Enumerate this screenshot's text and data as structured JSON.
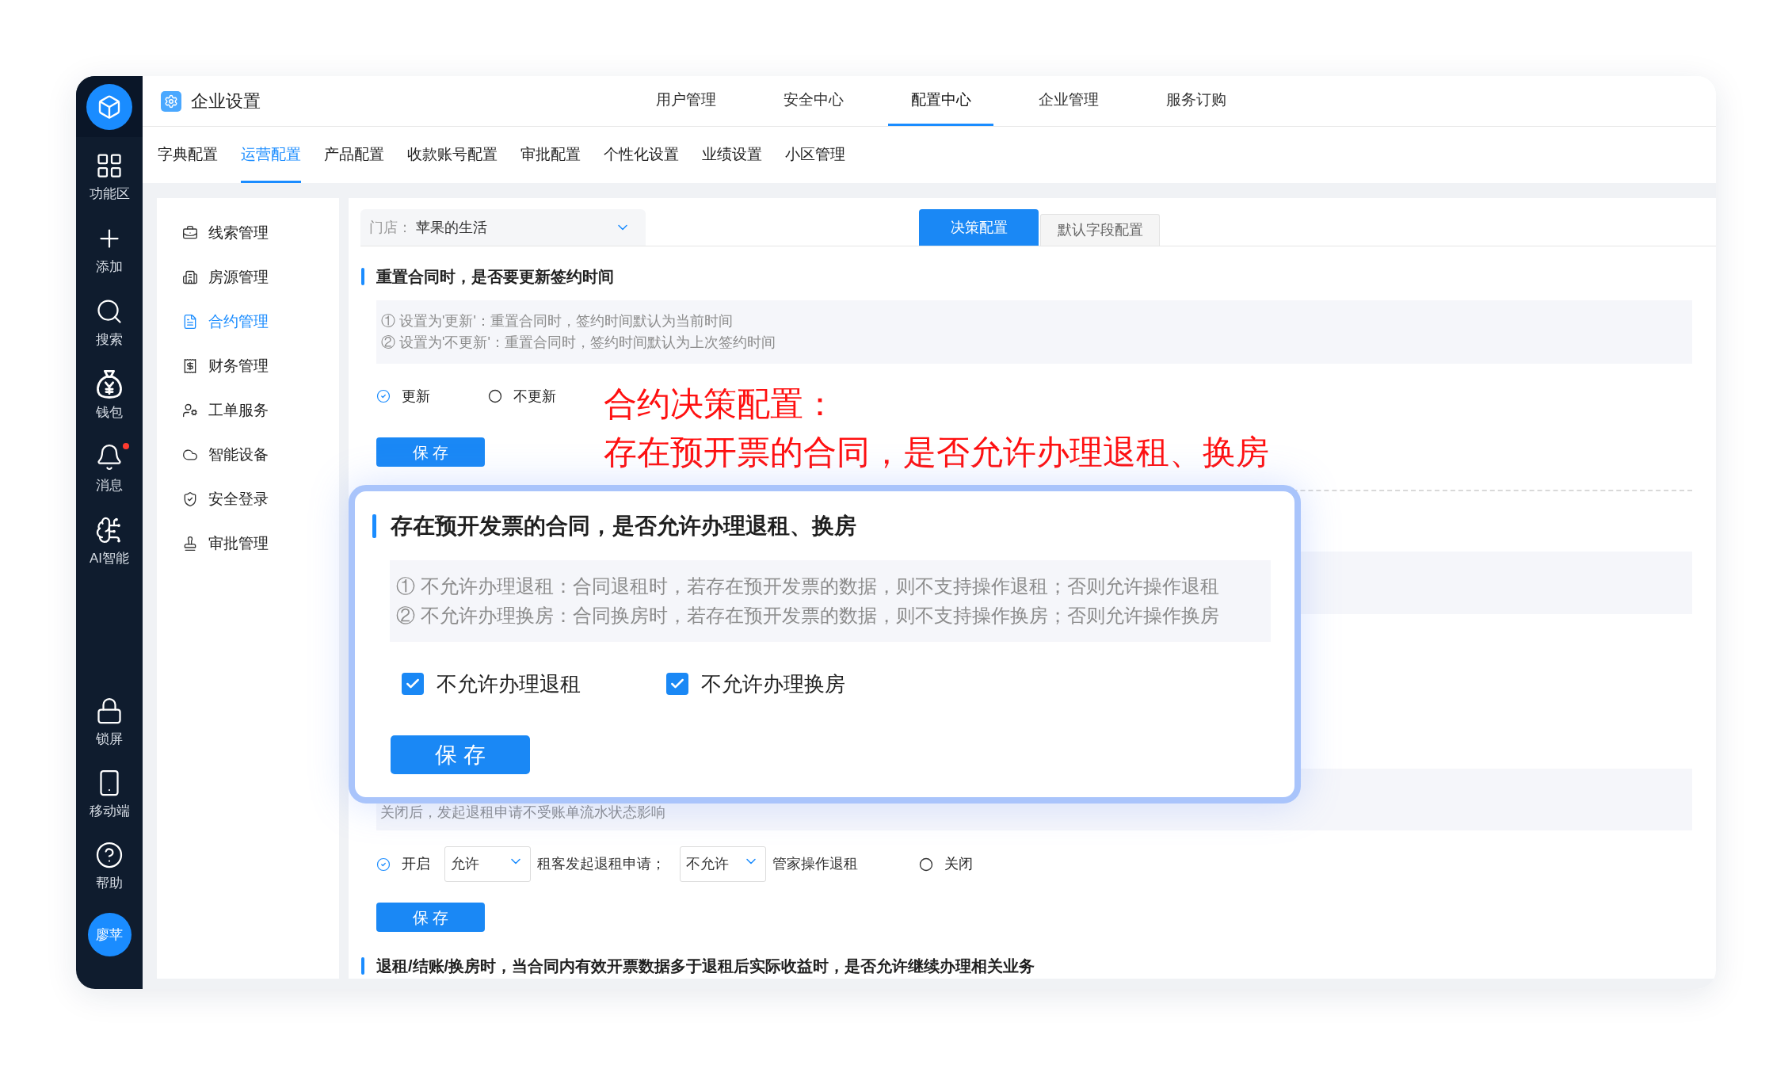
{
  "sidebar": {
    "top_items": [
      {
        "label": "功能区",
        "unread": false
      },
      {
        "label": "添加",
        "unread": false
      },
      {
        "label": "搜索",
        "unread": false
      },
      {
        "label": "钱包",
        "unread": false
      },
      {
        "label": "消息",
        "unread": true
      },
      {
        "label": "AI智能",
        "unread": false
      }
    ],
    "bottom_items": [
      {
        "label": "锁屏"
      },
      {
        "label": "移动端"
      },
      {
        "label": "帮助"
      }
    ],
    "avatar": "廖苹"
  },
  "header": {
    "title": "企业设置",
    "tabs": [
      {
        "label": "用户管理",
        "selected": false
      },
      {
        "label": "安全中心",
        "selected": false
      },
      {
        "label": "配置中心",
        "selected": true
      },
      {
        "label": "企业管理",
        "selected": false
      },
      {
        "label": "服务订购",
        "selected": false
      }
    ]
  },
  "sub_tabs": [
    {
      "label": "字典配置",
      "selected": false
    },
    {
      "label": "运营配置",
      "selected": true
    },
    {
      "label": "产品配置",
      "selected": false
    },
    {
      "label": "收款账号配置",
      "selected": false
    },
    {
      "label": "审批配置",
      "selected": false
    },
    {
      "label": "个性化设置",
      "selected": false
    },
    {
      "label": "业绩设置",
      "selected": false
    },
    {
      "label": "小区管理",
      "selected": false
    }
  ],
  "side_menu": [
    {
      "label": "线索管理",
      "selected": false
    },
    {
      "label": "房源管理",
      "selected": false
    },
    {
      "label": "合约管理",
      "selected": true
    },
    {
      "label": "财务管理",
      "selected": false
    },
    {
      "label": "工单服务",
      "selected": false
    },
    {
      "label": "智能设备",
      "selected": false
    },
    {
      "label": "安全登录",
      "selected": false
    },
    {
      "label": "审批管理",
      "selected": false
    }
  ],
  "store_select": {
    "label": "门店：",
    "value": "苹果的生活"
  },
  "config_tabs": [
    {
      "label": "决策配置",
      "selected": true
    },
    {
      "label": "默认字段配置",
      "selected": false
    }
  ],
  "reset_section": {
    "title": "重置合同时，是否要更新签约时间",
    "notes": [
      "① 设置为'更新'：重置合同时，签约时间默认为当前时间",
      "② 设置为'不更新'：重置合同时，签约时间默认为上次签约时间"
    ],
    "options": [
      {
        "label": "更新",
        "selected": true
      },
      {
        "label": "不更新",
        "selected": false
      }
    ],
    "save_button": "保 存"
  },
  "annotation": {
    "lines": [
      "合约决策配置：",
      "存在预开票的合同，是否允许办理退租、换房"
    ]
  },
  "popup": {
    "title": "存在预开发票的合同，是否允许办理退租、换房",
    "notes": [
      "① 不允许办理退租：合同退租时，若存在预开发票的数据，则不支持操作退租；否则允许操作退租",
      "② 不允许办理换房：合同换房时，若存在预开发票的数据，则不支持操作换房；否则允许操作换房"
    ],
    "checkboxes": [
      {
        "label": "不允许办理退租",
        "checked": true
      },
      {
        "label": "不允许办理换房",
        "checked": true
      }
    ],
    "save_button": "保 存"
  },
  "refund_section": {
    "notes": [
      "关闭后，发起退租申请不受账单流水状态影响"
    ],
    "controls": [
      {
        "kind": "radio",
        "label": "开启",
        "selected": true
      },
      {
        "kind": "select",
        "value": "允许"
      },
      {
        "kind": "text",
        "text": "租客发起退租申请；"
      },
      {
        "kind": "select",
        "value": "不允许"
      },
      {
        "kind": "text",
        "text": "管家操作退租"
      },
      {
        "kind": "radio",
        "label": "关闭",
        "selected": false
      }
    ],
    "save_button": "保 存"
  },
  "invoice_section": {
    "title": "退租/结账/换房时，当合同内有效开票数据多于退租后实际收益时，是否允许继续办理相关业务"
  }
}
